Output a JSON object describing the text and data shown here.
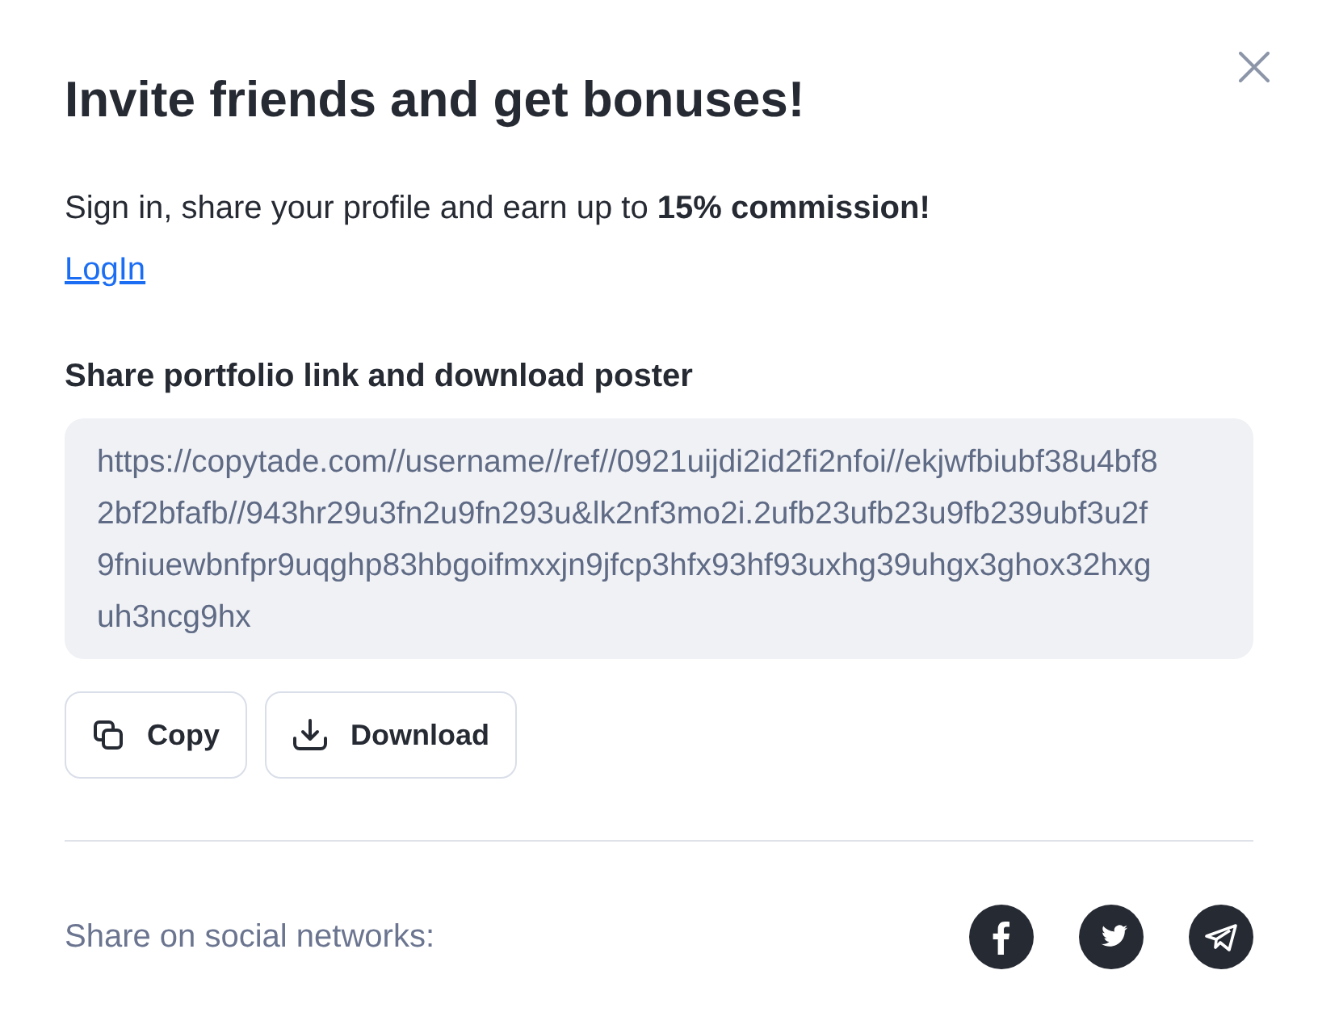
{
  "dialog": {
    "title": "Invite friends and get bonuses!",
    "subtitle": "Sign in, share your profile and earn up to **15% commission!**",
    "login_link": "LogIn"
  },
  "share": {
    "label": "Share portfolio link and download poster",
    "link": "https://copytade.com//username//ref//0921uijdi2id2fi2nfoi//ekjwfbiubf38u4bf82bf2bfafb//943hr29u3fn2u9fn293u&lk2nf3mo2i.2ufb23ufb23u9fb239ubf3u2f9fniuewbnfpr9uqghp83hbgoifmxxjn9jfcp3hfx93hf93uxhg39uhgx3ghox32hxguh3ncg9hx",
    "buttons": [
      {
        "kind": "copy",
        "label": "Copy"
      },
      {
        "kind": "download",
        "label": "Download"
      }
    ]
  },
  "social": {
    "label": "Share on social networks:",
    "networks": [
      {
        "kind": "facebook"
      },
      {
        "kind": "twitter"
      },
      {
        "kind": "telegram"
      }
    ]
  }
}
